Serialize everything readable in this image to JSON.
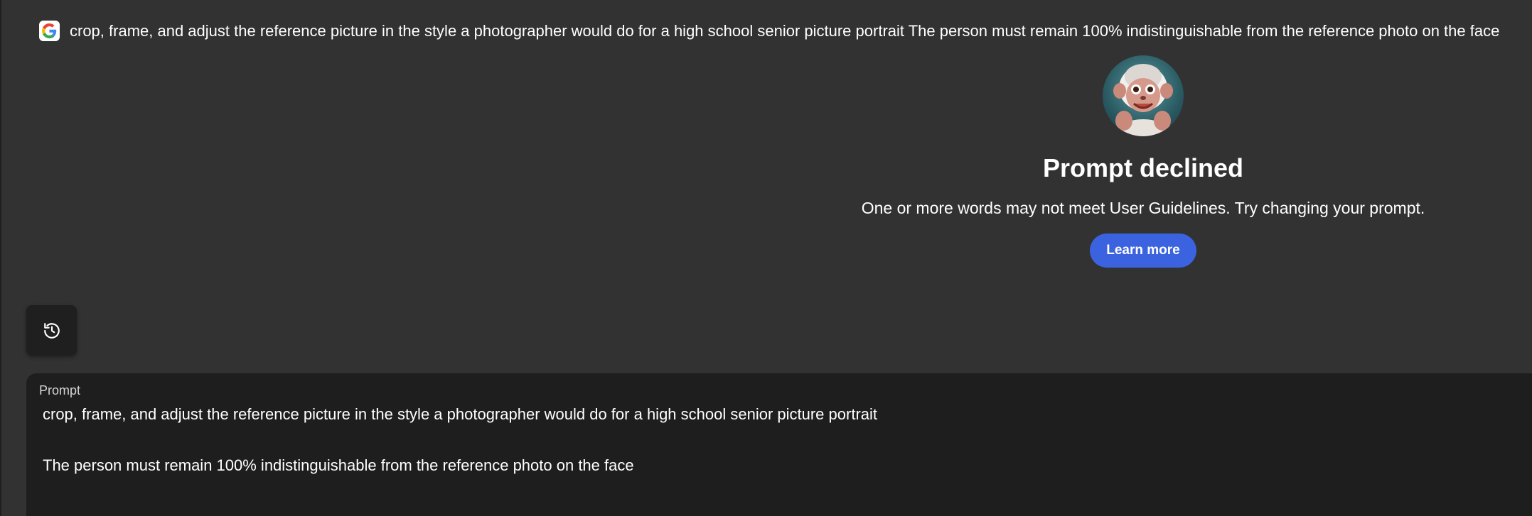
{
  "header": {
    "logo_icon": "google-g-icon",
    "prompt_text": "crop, frame, and adjust the reference picture in the style a photographer would do for a high school senior picture portrait The person must remain 100% indistinguishable from the reference photo on the face"
  },
  "decline": {
    "avatar_icon": "monkey-mascot-avatar",
    "title": "Prompt declined",
    "message": "One or more words may not meet User Guidelines. Try changing your prompt.",
    "learn_more_label": "Learn more",
    "button_color": "#3b63e0"
  },
  "history": {
    "icon": "history-icon"
  },
  "prompt_panel": {
    "label": "Prompt",
    "line1": "crop, frame, and adjust the reference picture in the style a photographer would do for a high school senior picture portrait",
    "line2": "The person must remain 100% indistinguishable from the reference photo on the face"
  }
}
